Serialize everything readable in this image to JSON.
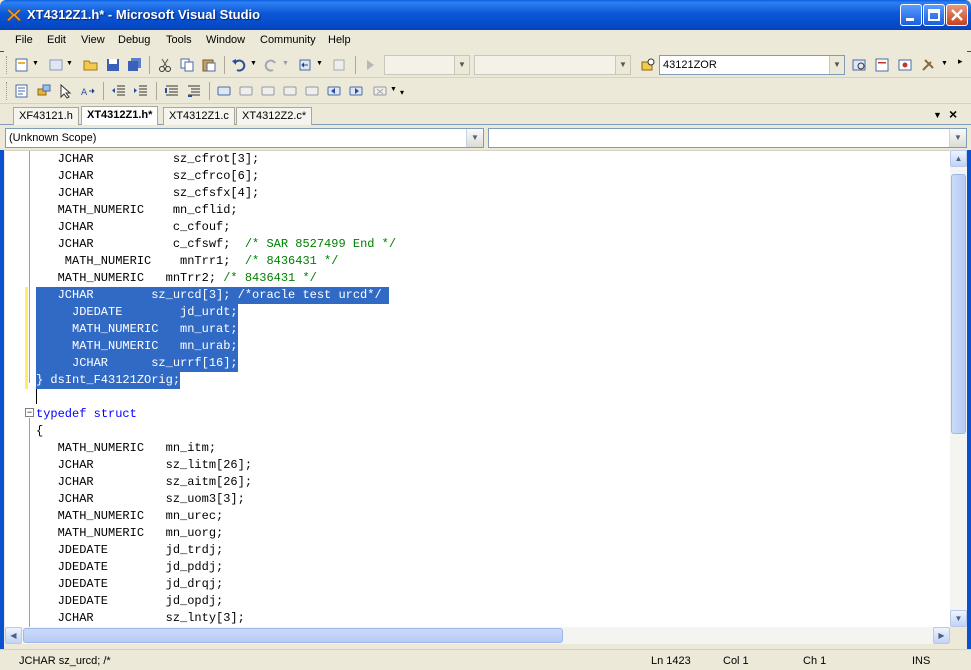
{
  "window": {
    "title": "XT4312Z1.h* - Microsoft Visual Studio",
    "colors": {
      "titlebar": "#0b58d8",
      "selection": "#316ac5",
      "keyword": "#0000ff",
      "comment": "#008000"
    }
  },
  "menu": {
    "items": [
      "File",
      "Edit",
      "View",
      "Debug",
      "Tools",
      "Window",
      "Community",
      "Help"
    ]
  },
  "toolbar": {
    "find_combo_value": "43121ZOR"
  },
  "tabs": [
    {
      "label": "XF43121.h",
      "active": false
    },
    {
      "label": "XT4312Z1.h*",
      "active": true
    },
    {
      "label": "XT4312Z1.c",
      "active": false
    },
    {
      "label": "XT4312Z2.c*",
      "active": false
    }
  ],
  "scope": {
    "left_value": "(Unknown Scope)",
    "right_value": ""
  },
  "code_lines": [
    "   JCHAR           sz_cfrot[3];",
    "   JCHAR           sz_cfrco[6];",
    "   JCHAR           sz_cfsfx[4];",
    "   MATH_NUMERIC    mn_cflid;",
    "   JCHAR           c_cfouf;",
    "   JCHAR           c_cfswf;  ",
    "    MATH_NUMERIC    mnTrr1;  ",
    "   MATH_NUMERIC   mnTrr2; ",
    "   JCHAR        sz_urcd[3]; /*oracle test urcd*/ ",
    "     JDEDATE        jd_urdt;",
    "     MATH_NUMERIC   mn_urat;",
    "     MATH_NUMERIC   mn_urab;",
    "     JCHAR      sz_urrf[16];",
    "} dsInt_F43121ZOrig;",
    "",
    "typedef struct",
    "{",
    "   MATH_NUMERIC   mn_itm;",
    "   JCHAR          sz_litm[26];",
    "   JCHAR          sz_aitm[26];",
    "   JCHAR          sz_uom3[3];",
    "   MATH_NUMERIC   mn_urec;",
    "   MATH_NUMERIC   mn_uorg;",
    "   JDEDATE        jd_trdj;",
    "   JDEDATE        jd_pddj;",
    "   JDEDATE        jd_drqj;",
    "   JDEDATE        jd_opdj;",
    "   JCHAR          sz_lnty[3];"
  ],
  "code_comments": {
    "line5": "/* SAR 8527499 End */",
    "line6": "/* 8436431 */",
    "line7": "/* 8436431 */"
  },
  "code_keywords": {
    "typedef": "typedef",
    "struct": "struct"
  },
  "status": {
    "message": "JCHAR sz_urcd; /*",
    "line": "Ln 1423",
    "col": "Col 1",
    "ch": "Ch 1",
    "mode": "INS"
  }
}
